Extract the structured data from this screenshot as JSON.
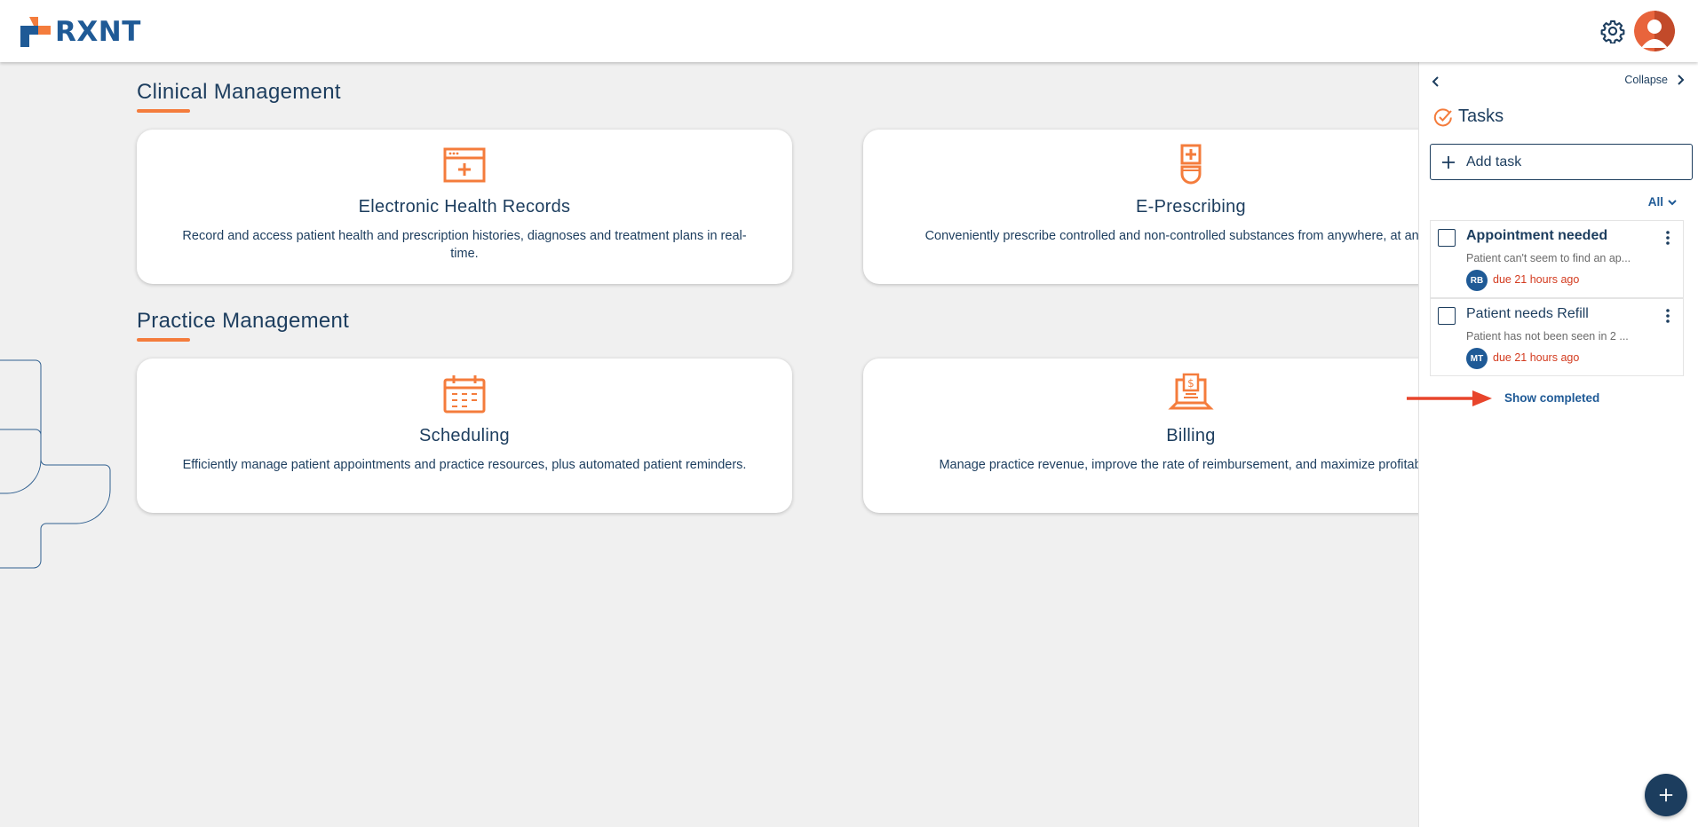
{
  "app": {
    "logo_text": "RXNT",
    "brand_color": "#1f5a96",
    "accent_color": "#f47c3c"
  },
  "header": {
    "icons": [
      "settings-gear-icon",
      "user-avatar-icon"
    ]
  },
  "sections": [
    {
      "title": "Clinical Management",
      "cards": [
        {
          "icon": "ehr-window-icon",
          "title": "Electronic Health Records",
          "description": "Record and access patient health and prescription histories, diagnoses and treatment plans in real-time."
        },
        {
          "icon": "prescription-bottle-icon",
          "title": "E-Prescribing",
          "description": "Conveniently prescribe controlled and non-controlled substances from anywhere, at any time."
        }
      ]
    },
    {
      "title": "Practice Management",
      "cards": [
        {
          "icon": "calendar-icon",
          "title": "Scheduling",
          "description": "Efficiently manage patient appointments and practice resources, plus automated patient reminders."
        },
        {
          "icon": "laptop-billing-icon",
          "title": "Billing",
          "description": "Manage practice revenue, improve the rate of reimbursement, and maximize profitability."
        }
      ]
    }
  ],
  "tasks_panel": {
    "collapse_label": "Collapse",
    "title": "Tasks",
    "add_task_label": "Add task",
    "filter_label": "All",
    "tasks": [
      {
        "title": "Appointment needed",
        "description": "Patient can't seem to find an ap...",
        "initials": "RB",
        "due": "due 21 hours ago",
        "unread": true
      },
      {
        "title": "Patient needs Refill",
        "description": "Patient has not been seen in 2 ...",
        "initials": "MT",
        "due": "due 21 hours ago",
        "unread": false
      }
    ],
    "show_completed_label": "Show completed"
  }
}
